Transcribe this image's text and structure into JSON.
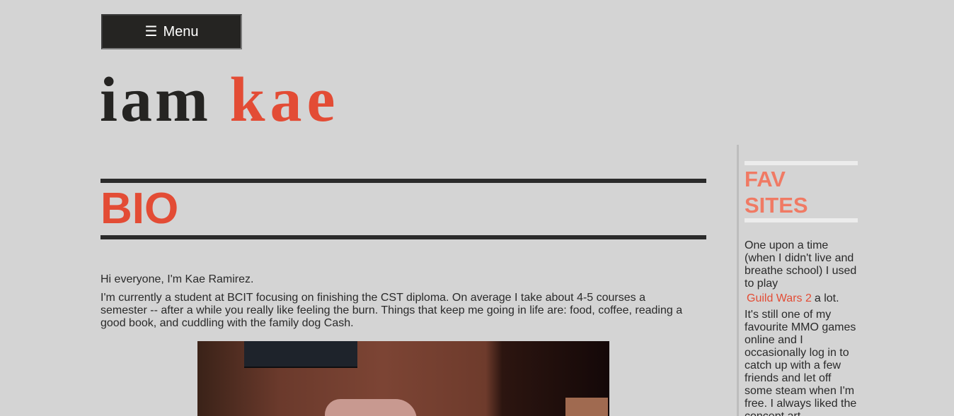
{
  "header": {
    "menu_icon": "☰",
    "menu_label": "Menu",
    "title_part1": "iam",
    "title_part2": "kae"
  },
  "main": {
    "heading": "BIO",
    "intro": "Hi everyone, I'm Kae Ramirez.",
    "paragraph": "I'm currently a student at BCIT focusing on finishing the CST diploma. On average I take about 4-5 courses a semester -- after a while you really like feeling the burn. Things that keep me going in life are: food, coffee, reading a good book, and cuddling with the family dog Cash.",
    "photo_icon": "photo-image"
  },
  "sidebar": {
    "heading_line1": "FAV",
    "heading_line2": "SITES",
    "text_before_link": "One upon a time (when I didn't live and breathe school) I used to play",
    "link_label": "Guild Wars 2",
    "text_after_link": "a lot.",
    "text_continued": "It's still one of my favourite MMO games online and I occasionally log in to catch up with a few friends and let off some steam when I'm free. I always liked the concept art"
  },
  "colors": {
    "background": "#d4d4d4",
    "accent": "#e34c35",
    "sidebar_accent": "#f07a64",
    "dark": "#252422"
  }
}
